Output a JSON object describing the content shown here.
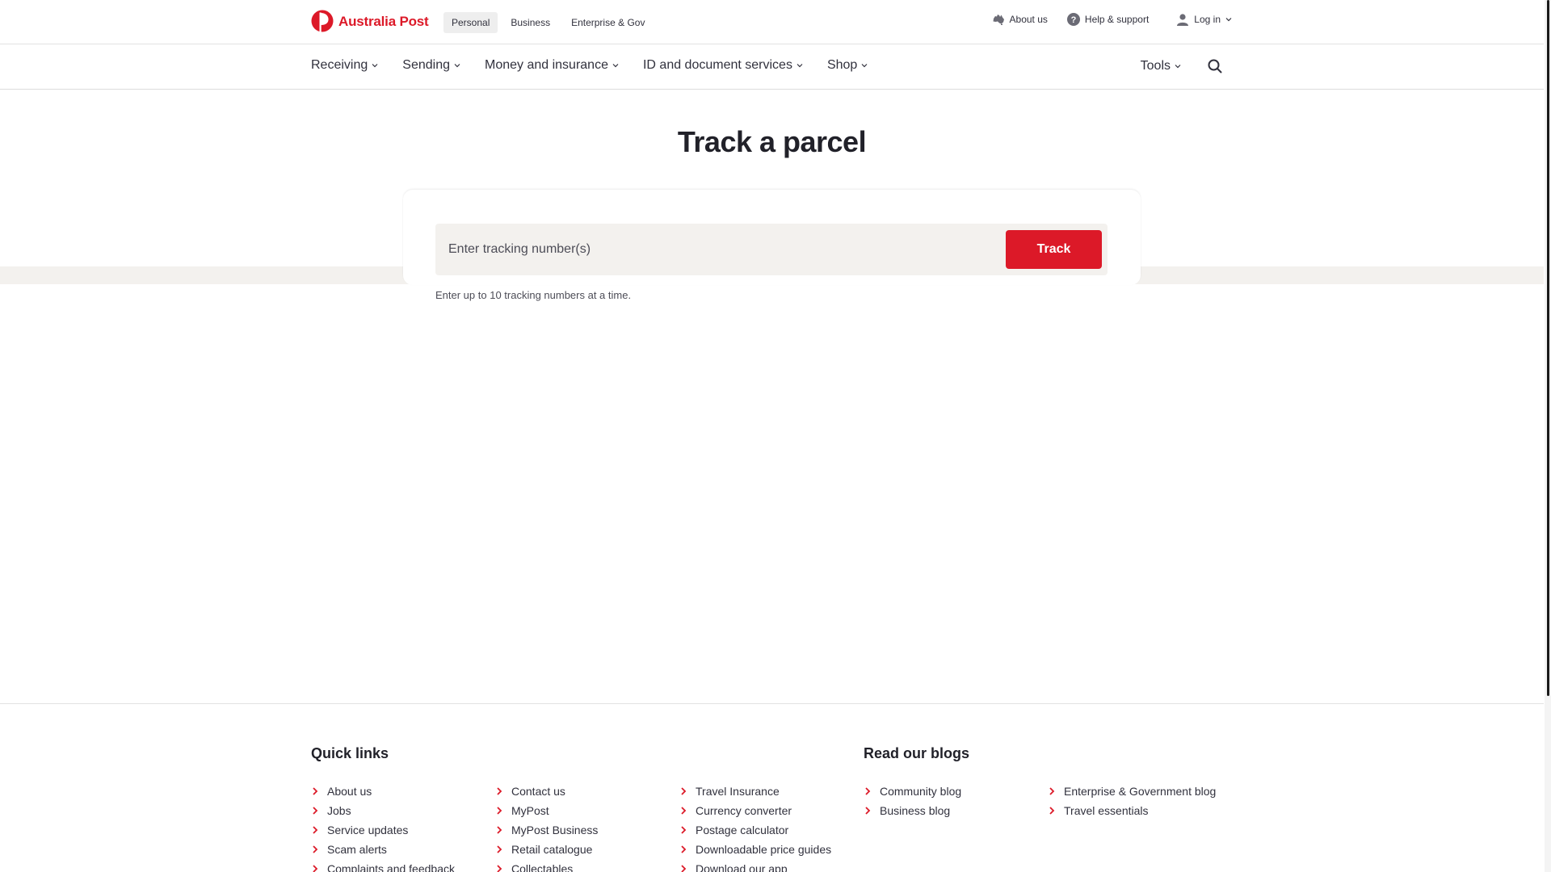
{
  "brand": {
    "name": "Australia Post",
    "accent_color": "#dc1928"
  },
  "segments": [
    {
      "label": "Personal",
      "active": true
    },
    {
      "label": "Business",
      "active": false
    },
    {
      "label": "Enterprise & Gov",
      "active": false
    }
  ],
  "utility": {
    "about": {
      "label": "About us",
      "icon": "australia-map-icon"
    },
    "help": {
      "label": "Help & support",
      "icon": "question-icon"
    },
    "login": {
      "label": "Log in",
      "icon": "user-icon"
    }
  },
  "nav": {
    "items": [
      {
        "label": "Receiving"
      },
      {
        "label": "Sending"
      },
      {
        "label": "Money and insurance"
      },
      {
        "label": "ID and document services"
      },
      {
        "label": "Shop"
      }
    ],
    "tools": {
      "label": "Tools"
    },
    "search_icon": "search-icon"
  },
  "page": {
    "title": "Track a parcel",
    "input_placeholder": "Enter tracking number(s)",
    "input_value": "",
    "track_button": "Track",
    "helper": "Enter up to 10 tracking numbers at a time."
  },
  "footer": {
    "quick_links_heading": "Quick links",
    "blogs_heading": "Read our blogs",
    "quick_links": [
      [
        "About us",
        "Jobs",
        "Service updates",
        "Scam alerts",
        "Complaints and feedback"
      ],
      [
        "Contact us",
        "MyPost",
        "MyPost Business",
        "Retail catalogue",
        "Collectables"
      ],
      [
        "Travel Insurance",
        "Currency converter",
        "Postage calculator",
        "Downloadable price guides",
        "Download our app"
      ]
    ],
    "blogs": [
      [
        "Community blog",
        "Business blog"
      ],
      [
        "Enterprise & Government blog",
        "Travel essentials"
      ]
    ]
  }
}
